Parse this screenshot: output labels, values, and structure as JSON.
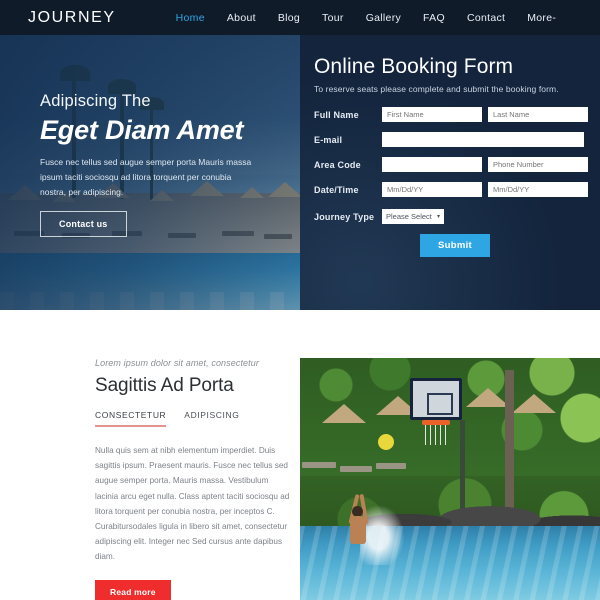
{
  "nav": {
    "logo": "JOURNEY",
    "items": [
      {
        "label": "Home",
        "active": true
      },
      {
        "label": "About",
        "active": false
      },
      {
        "label": "Blog",
        "active": false
      },
      {
        "label": "Tour",
        "active": false
      },
      {
        "label": "Gallery",
        "active": false
      },
      {
        "label": "FAQ",
        "active": false
      },
      {
        "label": "Contact",
        "active": false
      },
      {
        "label": "More-",
        "active": false
      }
    ],
    "active_color": "#2fa6e4",
    "background": "#101b2a"
  },
  "hero": {
    "kicker": "Adipiscing The",
    "title": "Eget Diam Amet",
    "paragraph": "Fusce nec tellus sed augue semper porta Mauris massa ipsum taciti sociosqu ad litora torquent per conubia nostra, per adipiscing.",
    "button_label": "Contact us",
    "image_description": "resort-pool-with-thatched-umbrellas-and-palm-trees"
  },
  "booking_form": {
    "title": "Online Booking Form",
    "subtitle": "To reserve seats please complete and submit the booking form.",
    "background": "#13243c",
    "rows": [
      {
        "label": "Full Name",
        "fields": [
          {
            "name": "first-name-input",
            "placeholder": "First Name",
            "value": "",
            "width": "half"
          },
          {
            "name": "last-name-input",
            "placeholder": "Last Name",
            "value": "",
            "width": "half"
          }
        ]
      },
      {
        "label": "E-mail",
        "fields": [
          {
            "name": "email-input",
            "placeholder": "",
            "value": "",
            "width": "full"
          }
        ]
      },
      {
        "label": "Area Code",
        "fields": [
          {
            "name": "area-code-input",
            "placeholder": "",
            "value": "",
            "width": "half"
          },
          {
            "name": "phone-number-input",
            "placeholder": "Phone Number",
            "value": "",
            "width": "half"
          }
        ]
      },
      {
        "label": "Date/Time",
        "fields": [
          {
            "name": "date-from-input",
            "placeholder": "Mm/Dd/YY",
            "value": "",
            "width": "half"
          },
          {
            "name": "date-to-input",
            "placeholder": "Mm/Dd/YY",
            "value": "",
            "width": "half"
          }
        ]
      }
    ],
    "journey_type": {
      "label": "Journey Type",
      "selected": "Please Select",
      "caret": "▾"
    },
    "submit_label": "Submit",
    "submit_color": "#2fa6e4"
  },
  "content": {
    "eyebrow": "Lorem ipsum dolor sit amet, consectetur",
    "title": "Sagittis Ad Porta",
    "tabs": [
      {
        "label": "CONSECTETUR",
        "active": true
      },
      {
        "label": "ADIPISCING",
        "active": false
      }
    ],
    "tab_underline_color": "#e4928e",
    "paragraph": "Nulla quis sem at nibh elementum imperdiet. Duis sagittis ipsum. Praesent mauris. Fusce nec tellus sed augue semper porta. Mauris massa. Vestibulum lacinia arcu eget nulla. Class aptent taciti sociosqu ad litora torquent per conubia nostra, per inceptos C. Curabitursodales ligula in libero sit amet, consectetur adipiscing elit. Integer nec Sed cursus ante dapibus diam.",
    "button_label": "Read more",
    "button_color": "#ef2d2d",
    "image_description": "man-playing-basketball-in-swimming-pool-with-tropical-foliage"
  }
}
